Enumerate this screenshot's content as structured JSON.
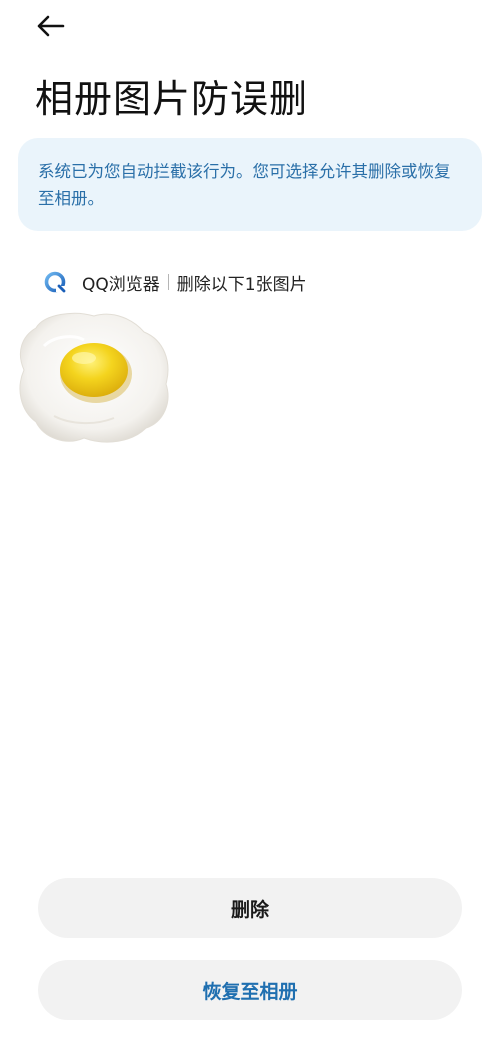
{
  "header": {
    "title": "相册图片防误删",
    "back_icon": "arrow-left-icon"
  },
  "notice": {
    "text": "系统已为您自动拦截该行为。您可选择允许其删除或恢复至相册。"
  },
  "source": {
    "app_icon": "qq-browser-icon",
    "app_name": "QQ浏览器",
    "description": "删除以下1张图片"
  },
  "photos": [
    {
      "icon": "fried-egg-image"
    }
  ],
  "actions": {
    "delete_label": "删除",
    "restore_label": "恢复至相册"
  },
  "colors": {
    "notice_bg": "#eaf4fb",
    "notice_text": "#2a6fa8",
    "accent": "#1f6fb0",
    "button_bg": "#f2f2f2"
  }
}
